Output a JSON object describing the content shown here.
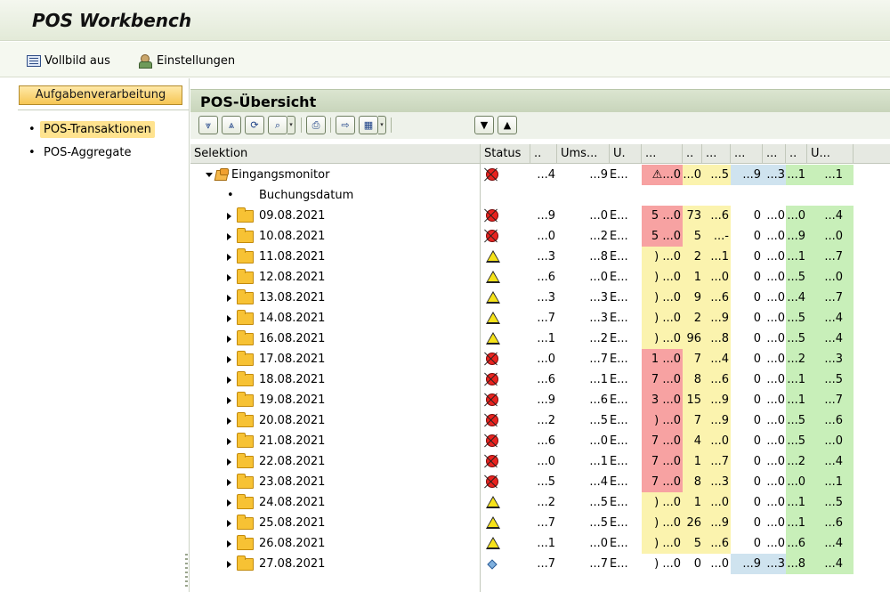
{
  "window": {
    "title": "POS Workbench"
  },
  "toolbar": {
    "fullscreen": "Vollbild aus",
    "settings": "Einstellungen"
  },
  "left": {
    "tab": "Aufgabenverarbeitung",
    "items": [
      {
        "label": "POS-Transaktionen",
        "selected": true
      },
      {
        "label": "POS-Aggregate",
        "selected": false
      }
    ]
  },
  "main": {
    "title": "POS-Übersicht",
    "columns": [
      "Selektion",
      "Status",
      "..",
      "Ums...",
      "U.",
      "...",
      "..",
      "...",
      "...",
      "...",
      "..",
      "U..."
    ],
    "root": {
      "label": "Eingangsmonitor",
      "status": "red",
      "vals": [
        "...4",
        "...9",
        "E...",
        "&#x26A0;...0",
        "...0",
        "...5",
        "...9",
        "...3",
        "...1",
        "...1"
      ]
    },
    "subheader": "Buchungsdatum",
    "rows": [
      {
        "date": "09.08.2021",
        "status": "red",
        "vals": [
          "...9",
          "...0",
          "E...",
          "5 ...0",
          "73",
          "...6",
          "0",
          "...0",
          "...0",
          "...4"
        ],
        "d1": "red"
      },
      {
        "date": "10.08.2021",
        "status": "red",
        "vals": [
          "...0",
          "...2",
          "E...",
          "5 ...0",
          "5",
          "...-",
          "0",
          "...0",
          "...9",
          "...0"
        ],
        "d1": "red"
      },
      {
        "date": "11.08.2021",
        "status": "yellow",
        "vals": [
          "...3",
          "...8",
          "E...",
          ") ...0",
          "2",
          "...1",
          "0",
          "...0",
          "...1",
          "...7"
        ],
        "d1": "yellow"
      },
      {
        "date": "12.08.2021",
        "status": "yellow",
        "vals": [
          "...6",
          "...0",
          "E...",
          ") ...0",
          "1",
          "...0",
          "0",
          "...0",
          "...5",
          "...0"
        ],
        "d1": "yellow"
      },
      {
        "date": "13.08.2021",
        "status": "yellow",
        "vals": [
          "...3",
          "...3",
          "E...",
          ") ...0",
          "9",
          "...6",
          "0",
          "...0",
          "...4",
          "...7"
        ],
        "d1": "yellow"
      },
      {
        "date": "14.08.2021",
        "status": "yellow",
        "vals": [
          "...7",
          "...3",
          "E...",
          ") ...0",
          "2",
          "...9",
          "0",
          "...0",
          "...5",
          "...4"
        ],
        "d1": "yellow"
      },
      {
        "date": "16.08.2021",
        "status": "yellow",
        "vals": [
          "...1",
          "...2",
          "E...",
          ") ...0",
          "96",
          "...8",
          "0",
          "...0",
          "...5",
          "...4"
        ],
        "d1": "yellow"
      },
      {
        "date": "17.08.2021",
        "status": "red",
        "vals": [
          "...0",
          "...7",
          "E...",
          "1 ...0",
          "7",
          "...4",
          "0",
          "...0",
          "...2",
          "...3"
        ],
        "d1": "red"
      },
      {
        "date": "18.08.2021",
        "status": "red",
        "vals": [
          "...6",
          "...1",
          "E...",
          "7 ...0",
          "8",
          "...6",
          "0",
          "...0",
          "...1",
          "...5"
        ],
        "d1": "red"
      },
      {
        "date": "19.08.2021",
        "status": "red",
        "vals": [
          "...9",
          "...6",
          "E...",
          "3 ...0",
          "15",
          "...9",
          "0",
          "...0",
          "...1",
          "...7"
        ],
        "d1": "red"
      },
      {
        "date": "20.08.2021",
        "status": "red",
        "vals": [
          "...2",
          "...5",
          "E...",
          ") ...0",
          "7",
          "...9",
          "0",
          "...0",
          "...5",
          "...6"
        ],
        "d1": "red"
      },
      {
        "date": "21.08.2021",
        "status": "red",
        "vals": [
          "...6",
          "...0",
          "E...",
          "7 ...0",
          "4",
          "...0",
          "0",
          "...0",
          "...5",
          "...0"
        ],
        "d1": "red"
      },
      {
        "date": "22.08.2021",
        "status": "red",
        "vals": [
          "...0",
          "...1",
          "E...",
          "7 ...0",
          "1",
          "...7",
          "0",
          "...0",
          "...2",
          "...4"
        ],
        "d1": "red"
      },
      {
        "date": "23.08.2021",
        "status": "red",
        "vals": [
          "...5",
          "...4",
          "E...",
          "7 ...0",
          "8",
          "...3",
          "0",
          "...0",
          "...0",
          "...1"
        ],
        "d1": "red"
      },
      {
        "date": "24.08.2021",
        "status": "yellow",
        "vals": [
          "...2",
          "...5",
          "E...",
          ") ...0",
          "1",
          "...0",
          "0",
          "...0",
          "...1",
          "...5"
        ],
        "d1": "yellow"
      },
      {
        "date": "25.08.2021",
        "status": "yellow",
        "vals": [
          "...7",
          "...5",
          "E...",
          ") ...0",
          "26",
          "...9",
          "0",
          "...0",
          "...1",
          "...6"
        ],
        "d1": "yellow"
      },
      {
        "date": "26.08.2021",
        "status": "yellow",
        "vals": [
          "...1",
          "...0",
          "E...",
          ") ...0",
          "5",
          "...6",
          "0",
          "...0",
          "...6",
          "...4"
        ],
        "d1": "yellow"
      },
      {
        "date": "27.08.2021",
        "status": "blue",
        "vals": [
          "...7",
          "...7",
          "E...",
          ") ...0",
          "0",
          "...0",
          "...9",
          "...3",
          "...8",
          "...4"
        ],
        "d1": "none"
      }
    ]
  }
}
